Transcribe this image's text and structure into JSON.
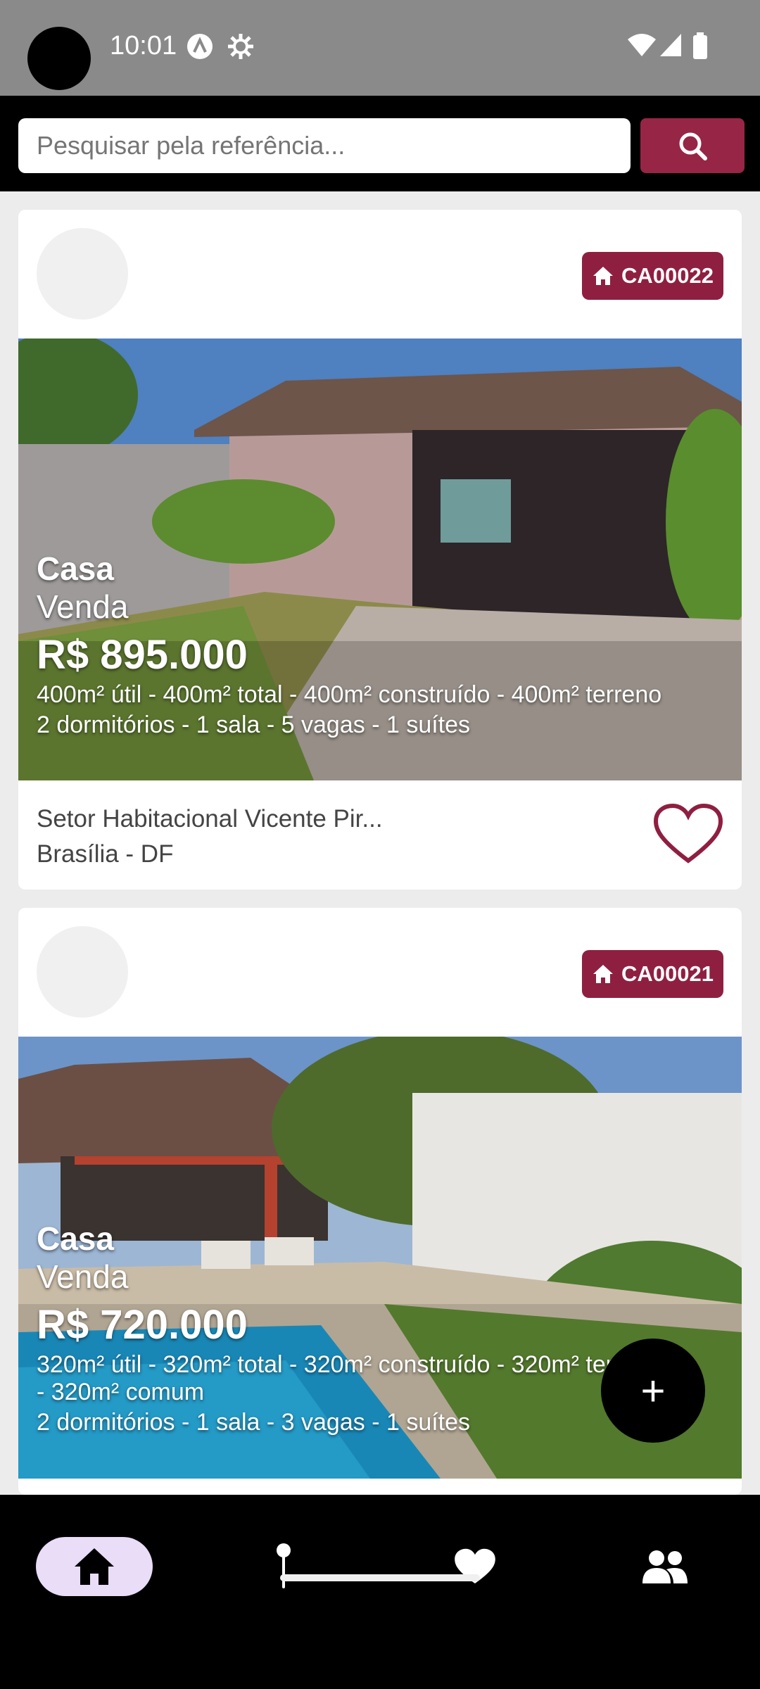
{
  "status_bar": {
    "time": "10:01"
  },
  "search": {
    "placeholder": "Pesquisar pela referência..."
  },
  "listings": [
    {
      "ref": "CA00022",
      "type": "Casa",
      "deal": "Venda",
      "price": "R$ 895.000",
      "areas": "400m² útil - 400m² total - 400m² construído - 400m² terreno",
      "rooms": "2 dormitórios - 1 sala - 5 vagas - 1 suítes",
      "address": "Setor Habitacional Vicente Pir...",
      "city": "Brasília - DF"
    },
    {
      "ref": "CA00021",
      "type": "Casa",
      "deal": "Venda",
      "price": "R$ 720.000",
      "areas_line1": "320m² útil - 320m² total - 320m² construído - 320m² terreno",
      "areas_line2": "- 320m² comum",
      "rooms": "2 dormitórios - 1 sala - 3 vagas - 1 suítes"
    }
  ],
  "fab": {
    "label": "+"
  },
  "colors": {
    "accent": "#8f1f40",
    "search_button": "#962546",
    "nav_active": "#e9ddf7"
  },
  "nav": [
    {
      "icon": "home-icon",
      "active": true
    },
    {
      "icon": "map-pin-icon",
      "active": false
    },
    {
      "icon": "heart-icon",
      "active": false
    },
    {
      "icon": "people-icon",
      "active": false
    }
  ]
}
